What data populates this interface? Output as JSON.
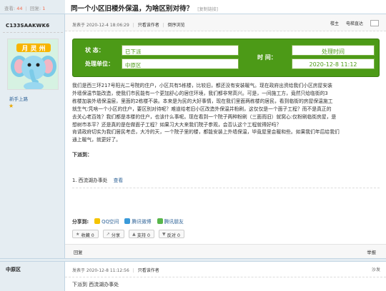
{
  "stats": {
    "views_label": "查看:",
    "views": "44",
    "replies_label": "回复:",
    "replies": "1"
  },
  "post": {
    "title": "同一个小区旧楼外保温，为啥区别对待？",
    "copy_link": "[复制链接]",
    "author": "C133SAAKWK6",
    "level": "新手上路",
    "meta": {
      "posted": "发表于 2020-12-4 18:06:29",
      "only_author": "只看该作者",
      "reverse": "倒序浏览"
    },
    "meta_right": {
      "stick": "楼主",
      "channel": "电梯直达"
    },
    "handle": {
      "status_label": "状    态：",
      "status_value": "已下派",
      "unit_label": "处理单位：",
      "unit_value": "中原区",
      "time_label": "时    间：",
      "time_title": "处理时间",
      "time_value": "2020-12-8  11:12"
    },
    "content": [
      "我们是西三环217号阳光二号院的住户，小区共有5栋楼，比较旧，都还没有安装暖气。现在政府出资给我们小区房屋安装",
      "外墙保温节能改造，使我们市民能有一个更加舒心的居住环境，我们都非常高兴。可是，一间施工方，竟然只给临街的3",
      "栋楼加装外墙保温层，里面的2栋楼不装。本来是为民的大好事情，现在我们里面两栋楼的居民，看到临街的房屋保温施工",
      "就生气:凭啥一个小区的住户，要区别对待呢？难道给老旧小区改造外保温并粉刷，这仅仅是一个面子工程？而不是真正的",
      "去关心老百姓？我们都是本楼的住户，也该什么事呢。现在看到一个院子两种粉刷（三面而旧）就窝心:仅粉刷临街房屋，是",
      "想树市本平？还是真的是在做面子工程？如果习大大来我们院子参观，会否认这个工程就得好吗？",
      "肯请政府切实为我们居民考虑，大冷的天，一个院子里的楼，都能安装上外墙保温，毕竟屋里会暖和些。如果我们年后给我们",
      "通上暖气，就更好了。"
    ],
    "assign_label": "下派到：",
    "assign_item": "1. 西流湖办事处",
    "assign_link": "查看",
    "share_label": "分享到:",
    "share": [
      "QQ空间",
      "腾讯微博",
      "腾讯朋友"
    ],
    "actions": [
      "收藏 0",
      "分享",
      "支持 0",
      "反对 0"
    ],
    "reply": "回复",
    "report": "举报"
  },
  "reply_post": {
    "author": "中原区",
    "meta": {
      "posted": "发表于 2020-12-8 11:12:56",
      "only_author": "只看该作者"
    },
    "floor": "沙发",
    "text": "下派到 西流湖办事处"
  },
  "colors": {
    "accent_green": "#4c9a17",
    "link_blue": "#336699",
    "stat_orange": "#f26c4f",
    "panel_blue": "#e5edf2"
  }
}
